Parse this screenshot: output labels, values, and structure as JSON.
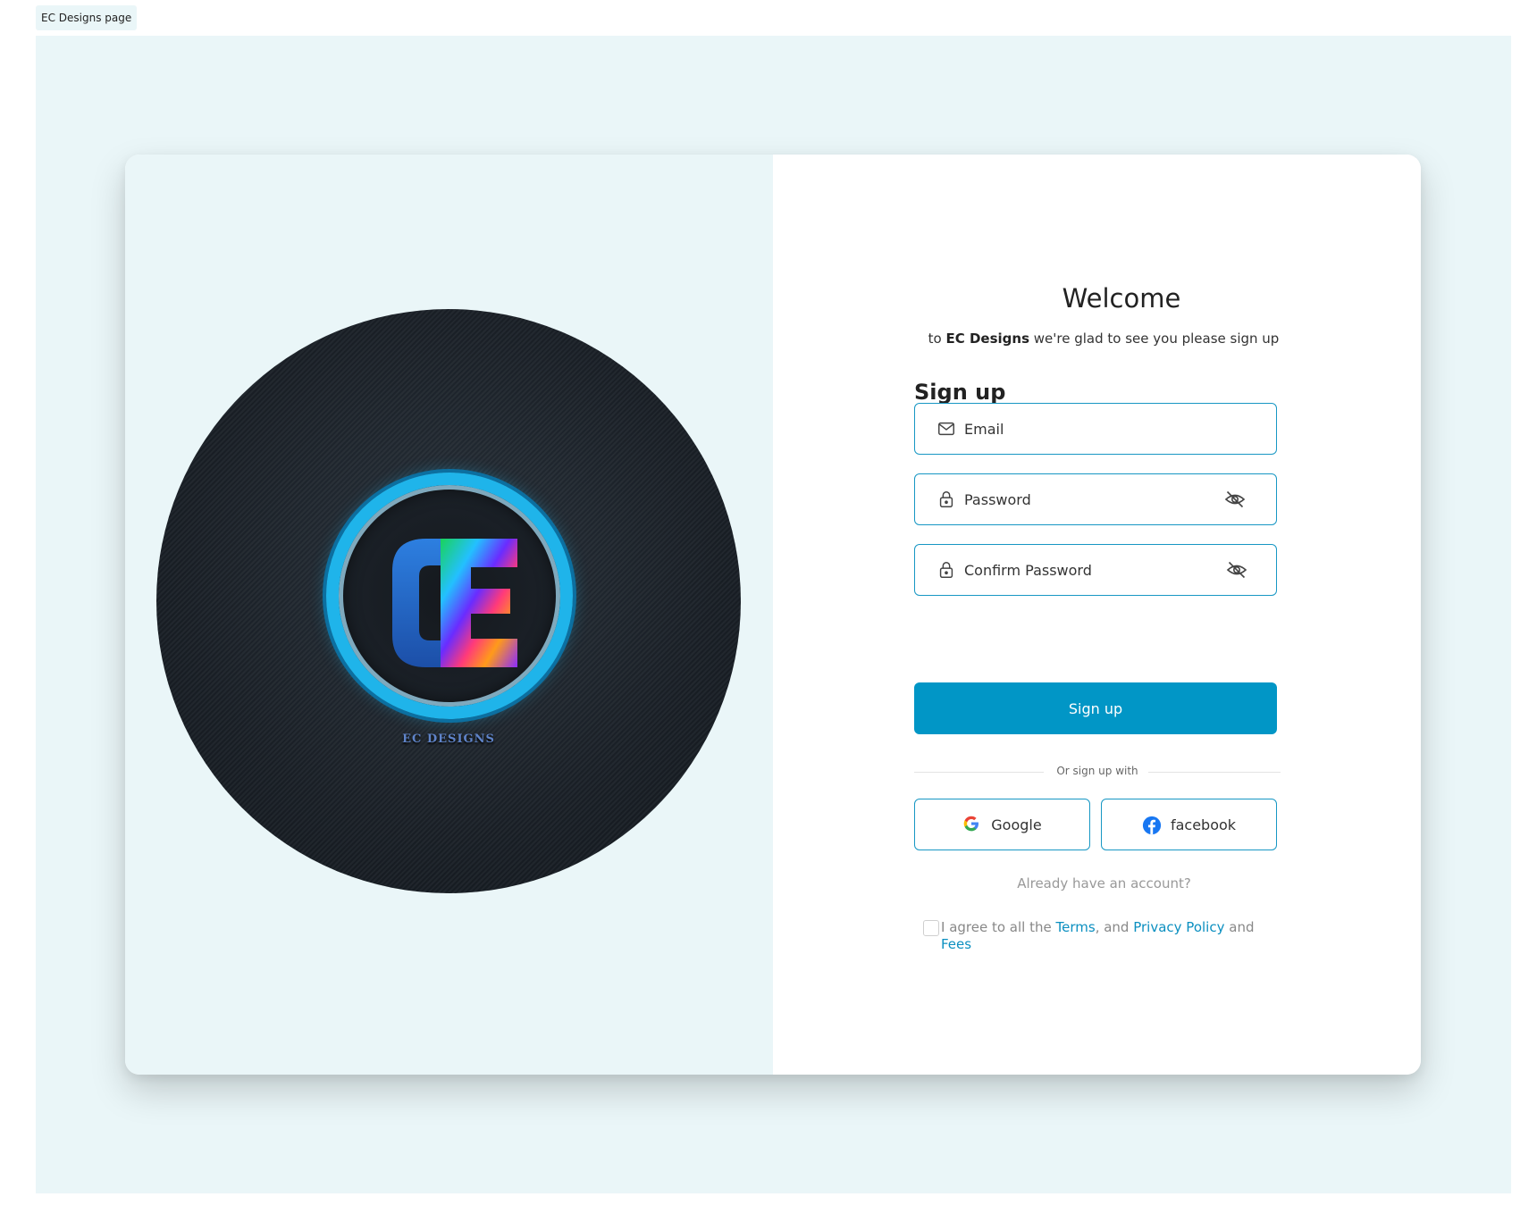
{
  "frame": {
    "label": "EC Designs page"
  },
  "brand": {
    "logo_text": "EC DESIGNS"
  },
  "header": {
    "title": "Welcome",
    "subtitle_prefix": "to",
    "brand_name": "EC Designs",
    "subtitle_suffix": "we're glad to see you please sign up"
  },
  "form": {
    "heading": "Sign up",
    "email_placeholder": "Email",
    "password_placeholder": "Password",
    "confirm_password_placeholder": "Confirm Password",
    "submit_label": "Sign up"
  },
  "social": {
    "divider_text": "Or sign up with",
    "google_label": "Google",
    "facebook_label": "facebook"
  },
  "footer": {
    "login_prompt": "Already have an account?",
    "agree_prefix": "I agree to all the",
    "terms_label": "Terms",
    "separator": ", and",
    "privacy_label": "Privacy Policy",
    "and_text": "and",
    "fees_label": "Fees",
    "agree_checked": false
  },
  "colors": {
    "accent": "#0196c6",
    "border": "#1797c4",
    "panel_background": "#eaf6f8",
    "link": "#0b8fc0"
  },
  "icons": {
    "email": "mail-icon",
    "password": "lock-icon",
    "visibility": "eye-off-icon",
    "google": "google-icon",
    "facebook": "facebook-icon"
  }
}
